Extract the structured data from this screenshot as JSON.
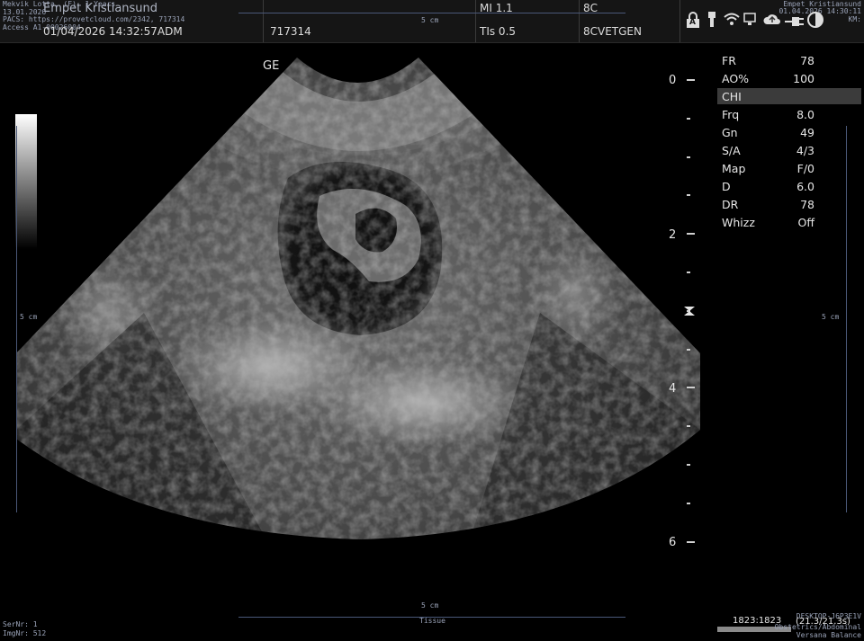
{
  "header": {
    "patient_line": "Mekvik Lotta, (F), 1 Years",
    "overlay_line_2": "13.01.2026",
    "clinic_name": "Empet Kristiansund",
    "pacs_url": "PACS: https://provetcloud.com/2342, 717314",
    "access_line": "Access A1-00026004",
    "datetime": "01/04/2026  14:32:57ADM",
    "patient_id": "717314",
    "scale_label_top": "5 cm",
    "mi": "MI 1.1",
    "tis": "TIs 0.5",
    "probe": "8C",
    "preset": "8CVETGEN",
    "clinic_right": "Empet Kristiansund",
    "datetime_right": "01.04.2026 14:30:11",
    "km": "KM:"
  },
  "status_icons": [
    "lock-icon",
    "usb-icon",
    "wifi-icon",
    "network-icon",
    "cloud-upload-icon",
    "power-plug-icon",
    "half-circle-icon"
  ],
  "lock_letter": "A",
  "image": {
    "orientation_marker": "GE",
    "left_scale_label": "5 cm",
    "right_scale_label": "5 cm",
    "bottom_scale_label": "5 cm",
    "bottom_scale_caption": "Tissue",
    "focus_marker": "focus-marker-icon"
  },
  "depth_scale": {
    "labels": [
      "0",
      "2",
      "4",
      "6"
    ]
  },
  "params": [
    {
      "key": "FR",
      "value": "78"
    },
    {
      "key": "AO%",
      "value": "100"
    },
    {
      "key": "CHI",
      "value": ""
    },
    {
      "key": "Frq",
      "value": "8.0"
    },
    {
      "key": "Gn",
      "value": "49"
    },
    {
      "key": "S/A",
      "value": "4/3"
    },
    {
      "key": "Map",
      "value": "F/0"
    },
    {
      "key": "D",
      "value": "6.0"
    },
    {
      "key": "DR",
      "value": "78"
    },
    {
      "key": "Whizz",
      "value": "Off"
    }
  ],
  "footer": {
    "ser_nr": "SerNr: 1",
    "img_nr": "ImgNr: 512",
    "frame_counter": "1823:1823",
    "workstation": "DESKTOP-J6P3E1V",
    "timecode": "(21.3/21.3s)",
    "caption_2": "Obstetrics/Abdominal",
    "caption_3": "Versana Balance"
  },
  "colors": {
    "background": "#000000",
    "topbar": "#151515",
    "overlay_text": "#9aa3b8",
    "highlight_row": "#3b3b3b"
  }
}
